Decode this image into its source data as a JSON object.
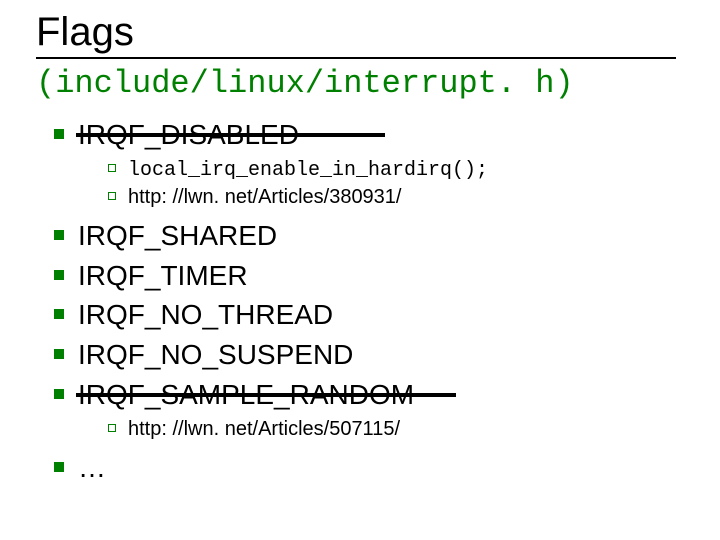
{
  "title": "Flags",
  "subtitle": "(include/linux/interrupt. h)",
  "items": [
    {
      "label": "IRQF_DISABLED",
      "strike": true,
      "strike_variant": "long",
      "sub": [
        {
          "label": "local_irq_enable_in_hardirq();",
          "mono": true
        },
        {
          "label": "http: //lwn. net/Articles/380931/"
        }
      ]
    },
    {
      "label": "IRQF_SHARED"
    },
    {
      "label": "IRQF_TIMER"
    },
    {
      "label": "IRQF_NO_THREAD"
    },
    {
      "label": "IRQF_NO_SUSPEND"
    },
    {
      "label": "IRQF_SAMPLE_RANDOM",
      "strike": true,
      "strike_variant": "short",
      "sub": [
        {
          "label": "http: //lwn. net/Articles/507115/"
        }
      ]
    },
    {
      "label": "…"
    }
  ]
}
